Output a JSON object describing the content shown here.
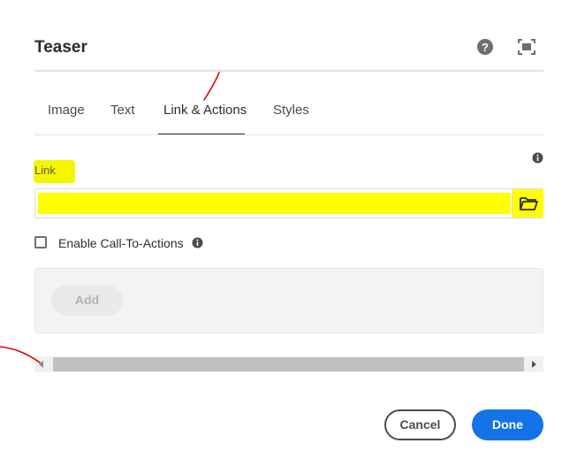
{
  "dialog": {
    "title": "Teaser"
  },
  "icons": {
    "help": "help-circle-icon",
    "fullscreen": "fullscreen-icon",
    "info": "info-icon",
    "browse": "folder-icon"
  },
  "tabs": [
    {
      "label": "Image",
      "selected": false
    },
    {
      "label": "Text",
      "selected": false
    },
    {
      "label": "Link & Actions",
      "selected": true
    },
    {
      "label": "Styles",
      "selected": false
    }
  ],
  "link_field": {
    "label": "Link",
    "value": "",
    "highlight_color": "#ffff00"
  },
  "cta": {
    "checkbox_label": "Enable Call-To-Actions",
    "checked": false,
    "add_label": "Add"
  },
  "footer": {
    "cancel_label": "Cancel",
    "done_label": "Done"
  },
  "colors": {
    "accent": "#1473e6",
    "annotation": "#e00000"
  }
}
